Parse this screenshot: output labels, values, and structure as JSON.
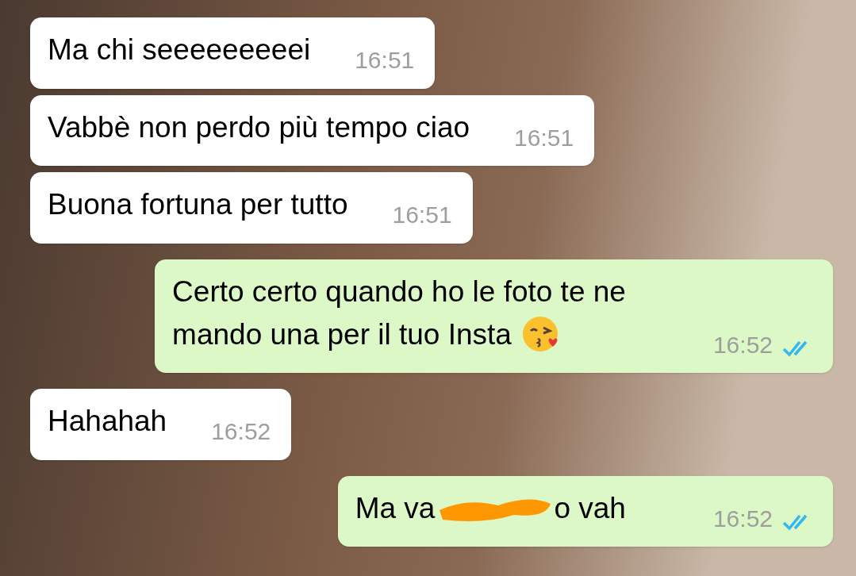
{
  "messages": [
    {
      "outgoing": false,
      "lines": [
        "Ma chi seeeeeeeeei"
      ],
      "time": "16:51"
    },
    {
      "outgoing": false,
      "lines": [
        "Vabbè non perdo più tempo ciao"
      ],
      "time": "16:51"
    },
    {
      "outgoing": false,
      "lines": [
        "Buona fortuna per tutto"
      ],
      "time": "16:51"
    },
    {
      "outgoing": true,
      "lines": [
        "Certo certo quando ho le foto te ne",
        "mando una per il tuo Insta"
      ],
      "emoji": true,
      "time": "16:52",
      "read": true
    },
    {
      "outgoing": false,
      "lines": [
        "Hahahah"
      ],
      "time": "16:52"
    },
    {
      "outgoing": true,
      "lines": [
        "Ma va",
        "o vah"
      ],
      "scribbled": true,
      "time": "16:52",
      "read": true
    }
  ]
}
